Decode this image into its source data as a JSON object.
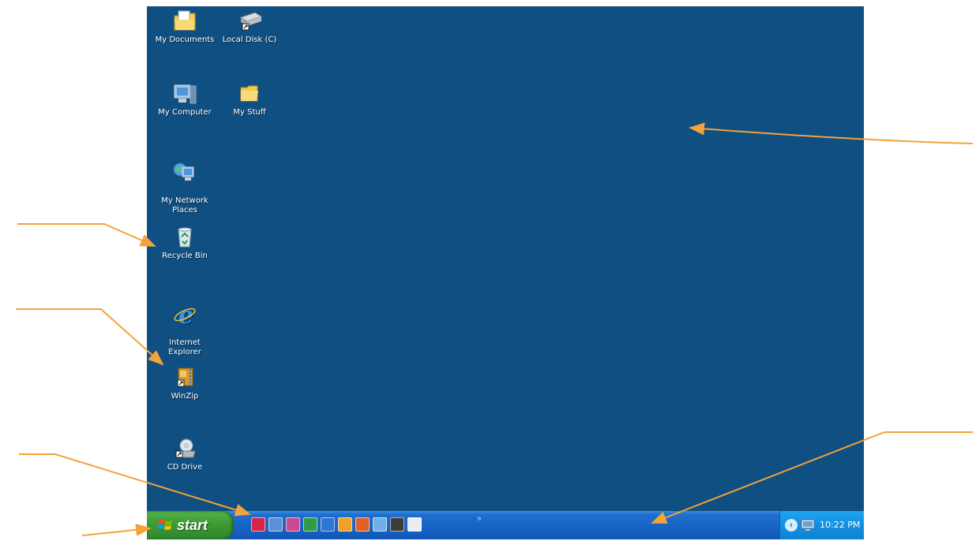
{
  "desktop": {
    "background": "#0f4f82",
    "icons": [
      {
        "label": "My Documents",
        "icon": "my-documents-icon"
      },
      {
        "label": "Local Disk (C)",
        "icon": "local-disk-icon"
      },
      {
        "label": "My Computer",
        "icon": "my-computer-icon"
      },
      {
        "label": "My Stuff",
        "icon": "folder-icon"
      },
      {
        "label": "My Network\nPlaces",
        "icon": "network-places-icon"
      },
      {
        "label": "Recycle Bin",
        "icon": "recycle-bin-icon"
      },
      {
        "label": "Internet\nExplorer",
        "icon": "internet-explorer-icon"
      },
      {
        "label": "WinZip",
        "icon": "winzip-icon"
      },
      {
        "label": "CD Drive",
        "icon": "cd-drive-icon"
      }
    ]
  },
  "taskbar": {
    "start_label": "start",
    "quick_launch": [
      {
        "icon": "acrobat-icon",
        "color": "#d4264a"
      },
      {
        "icon": "paint-icon",
        "color": "#5d8fd6"
      },
      {
        "icon": "photo-editor-icon",
        "color": "#c94a8e"
      },
      {
        "icon": "excel-icon",
        "color": "#2f9b45"
      },
      {
        "icon": "internet-explorer-icon",
        "color": "#2e77d1"
      },
      {
        "icon": "outlook-icon",
        "color": "#f0a128"
      },
      {
        "icon": "powerpoint-icon",
        "color": "#e0602a"
      },
      {
        "icon": "media-icon",
        "color": "#6fb0e8"
      },
      {
        "icon": "tv-icon",
        "color": "#3d3d3d"
      },
      {
        "icon": "messenger-icon",
        "color": "#e9eef6"
      }
    ],
    "chevron": "»",
    "tray": {
      "expand_glyph": "‹",
      "clock": "10:22 PM"
    }
  },
  "colors": {
    "annotation_arrow": "#f3a33a"
  }
}
